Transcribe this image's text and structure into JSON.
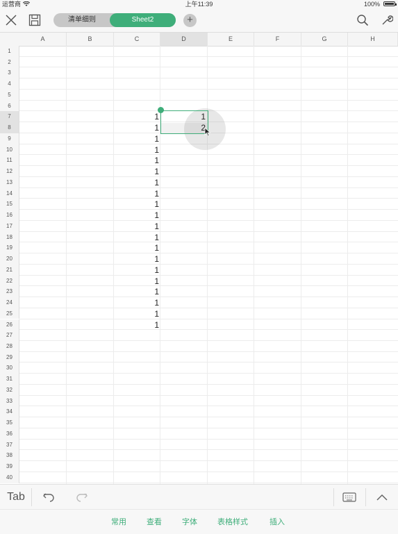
{
  "status_bar": {
    "carrier": "运营商",
    "time": "上午11:39",
    "battery": "100%"
  },
  "toolbar": {
    "tabs": [
      {
        "label": "清单细则",
        "active": false
      },
      {
        "label": "Sheet2",
        "active": true
      }
    ],
    "add_tab": "+"
  },
  "grid": {
    "columns": [
      "A",
      "B",
      "C",
      "D",
      "E",
      "F",
      "G",
      "H"
    ],
    "rows": [
      "1",
      "2",
      "3",
      "4",
      "5",
      "6",
      "7",
      "8",
      "9",
      "10",
      "11",
      "12",
      "13",
      "14",
      "15",
      "16",
      "17",
      "18",
      "19",
      "20",
      "21",
      "22",
      "23",
      "24",
      "25",
      "26",
      "27",
      "28",
      "29",
      "30",
      "31",
      "32",
      "33",
      "34",
      "35",
      "36",
      "37",
      "38",
      "39",
      "40"
    ],
    "selected_column": "D",
    "selected_rows": [
      "7",
      "8"
    ],
    "column_c_values": [
      {
        "row": "7",
        "value": "1"
      },
      {
        "row": "8",
        "value": "1"
      },
      {
        "row": "9",
        "value": "1"
      },
      {
        "row": "10",
        "value": "1"
      },
      {
        "row": "11",
        "value": "1"
      },
      {
        "row": "12",
        "value": "1"
      },
      {
        "row": "13",
        "value": "1"
      },
      {
        "row": "14",
        "value": "1"
      },
      {
        "row": "15",
        "value": "1"
      },
      {
        "row": "16",
        "value": "1"
      },
      {
        "row": "17",
        "value": "1"
      },
      {
        "row": "18",
        "value": "1"
      },
      {
        "row": "19",
        "value": "1"
      },
      {
        "row": "20",
        "value": "1"
      },
      {
        "row": "21",
        "value": "1"
      },
      {
        "row": "22",
        "value": "1"
      },
      {
        "row": "23",
        "value": "1"
      },
      {
        "row": "24",
        "value": "1"
      },
      {
        "row": "25",
        "value": "1"
      },
      {
        "row": "26",
        "value": "1"
      }
    ],
    "column_d_values": [
      {
        "row": "7",
        "value": "1"
      },
      {
        "row": "8",
        "value": "2"
      }
    ]
  },
  "keyboard_bar": {
    "tab_label": "Tab"
  },
  "menu_bar": {
    "items": [
      "常用",
      "查看",
      "字体",
      "表格样式",
      "插入"
    ]
  },
  "colors": {
    "accent": "#3fae7a"
  }
}
